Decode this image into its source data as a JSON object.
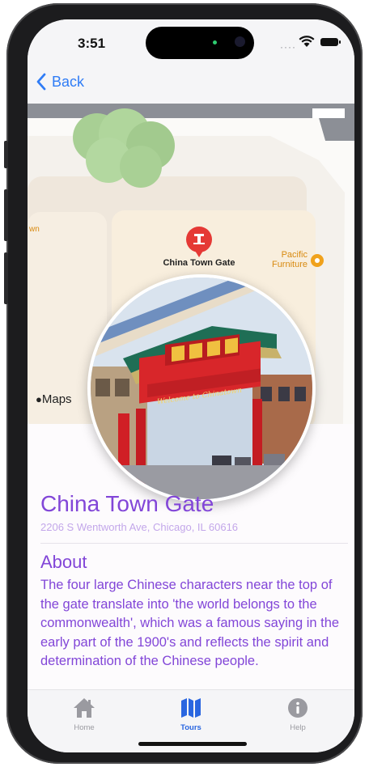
{
  "status_bar": {
    "time": "3:51"
  },
  "nav": {
    "back_label": "Back"
  },
  "map": {
    "pin_label": "China Town Gate",
    "poi_label": "Pacific\nFurniture",
    "edge_label": "wn",
    "attribution": "Maps"
  },
  "photo": {
    "sign_text": "Welcome to Chinatown"
  },
  "place": {
    "title": "China Town Gate",
    "address": "2206 S Wentworth Ave, Chicago, IL 60616"
  },
  "about": {
    "heading": "About",
    "text": "The four large Chinese characters near the top of the gate translate into 'the world belongs to the commonwealth', which was a famous saying in the early part of the 1900's and reflects the spirit and determination of the Chinese people."
  },
  "tabs": [
    {
      "label": "Home",
      "icon": "house-icon",
      "active": false
    },
    {
      "label": "Tours",
      "icon": "map-icon",
      "active": true
    },
    {
      "label": "Help",
      "icon": "info-icon",
      "active": false
    }
  ],
  "colors": {
    "accent_purple": "#8246d8",
    "link_blue": "#2f7cf6",
    "pin_red": "#e53935",
    "poi_orange": "#f0a21c"
  }
}
